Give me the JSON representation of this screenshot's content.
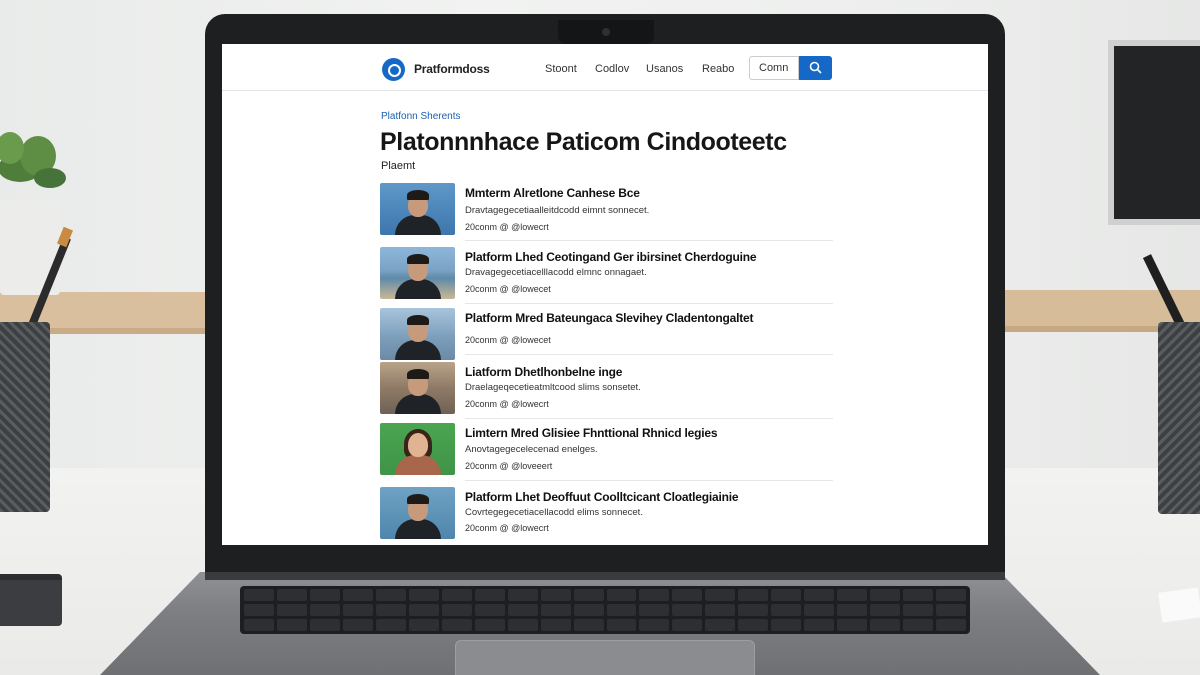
{
  "header": {
    "brand": "Pratformdoss",
    "nav": [
      "Stoont",
      "Codlov",
      "Usanos",
      "Reabo"
    ],
    "search_value": "Comn"
  },
  "page": {
    "breadcrumb": "Platfonn Sherents",
    "title": "Platonnnhace Paticom Cindooteetc",
    "subhead": "Plaemt"
  },
  "items": [
    {
      "title": "Mmterm Alretlone Canhese Bce",
      "desc": "Dravtagegecetiaalleitdcodd eimnt sonnecet.",
      "meta": "20conm @ @lowecrt",
      "thumb": "blue"
    },
    {
      "title": "Platform Lhed Ceotingand Ger ibirsinet Cherdoguine",
      "desc": "Dravagegecetiacelllacodd elmnc onnagaet.",
      "meta": "20conm @ @lowecet",
      "thumb": "harbor"
    },
    {
      "title": "Platform Mred Bateungaca Slevihey Cladentongaltet",
      "desc": "",
      "meta": "20conm @ @lowecet",
      "thumb": "city"
    },
    {
      "title": "Liatform Dhetlhonbelne inge",
      "desc": "Draelageqecetieatmltcood slims sonsetet.",
      "meta": "20conm @ @lowecrt",
      "thumb": "bridge"
    },
    {
      "title": "Limtern Mred Glisiee Fhnttional Rhnicd legies",
      "desc": "Anovtagegecelecenad enelges.",
      "meta": "20conm @ @loveeert",
      "thumb": "green"
    },
    {
      "title": "Platform Lhet Deoffuut Coolltcicant Cloatlegiainie",
      "desc": "Covrtegegecetiacellacodd elims sonnecet.",
      "meta": "20conm @ @lowecrt",
      "thumb": "teal"
    }
  ]
}
